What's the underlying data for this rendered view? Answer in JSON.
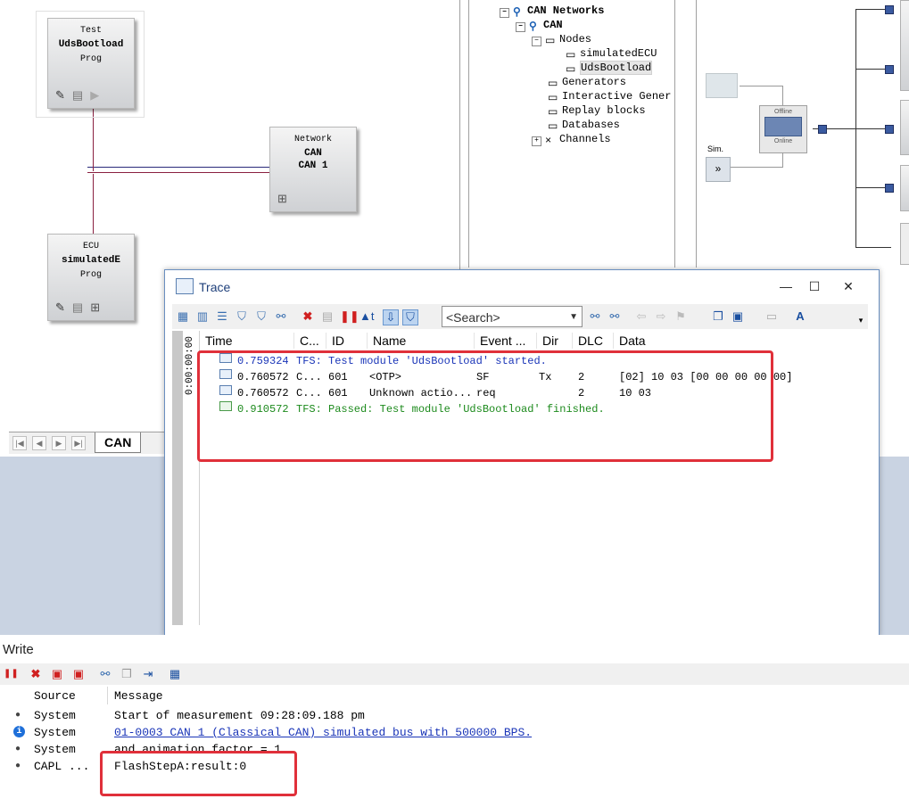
{
  "simulation": {
    "blocks": [
      {
        "line1": "Test",
        "line2": "UdsBootload",
        "line3": "Prog"
      },
      {
        "line1": "Network",
        "line2": "CAN",
        "line3": "CAN 1"
      },
      {
        "line1": "ECU",
        "line2": "simulatedE",
        "line3": "Prog"
      }
    ],
    "tab_label": "CAN"
  },
  "tree": {
    "items": [
      {
        "label": "CAN Networks",
        "icon": "network-icon",
        "bold": true
      },
      {
        "label": "CAN",
        "icon": "bus-icon",
        "bold": true
      },
      {
        "label": "Nodes",
        "icon": "nodes-icon"
      },
      {
        "label": "simulatedECU",
        "icon": "node-icon"
      },
      {
        "label": "UdsBootload",
        "icon": "node-icon"
      },
      {
        "label": "Generators",
        "icon": "generator-icon"
      },
      {
        "label": "Interactive Gener",
        "icon": "interactive-generator-icon"
      },
      {
        "label": "Replay blocks",
        "icon": "replay-icon"
      },
      {
        "label": "Databases",
        "icon": "database-icon"
      },
      {
        "label": "Channels",
        "icon": "channels-icon"
      }
    ]
  },
  "schematic": {
    "sim_label": "Sim.",
    "switch_top": "Offline",
    "switch_bottom": "Online"
  },
  "trace": {
    "title": "Trace",
    "search_placeholder": "<Search>",
    "time_axis_label": "0:00:00:00",
    "columns": [
      "Time",
      "C...",
      "ID",
      "Name",
      "Event ...",
      "Dir",
      "DLC",
      "Data"
    ],
    "rows": [
      {
        "time": "0.759324",
        "rest": "TFS: Test module 'UdsBootload' started.",
        "color": "#1a35b8",
        "kind": "tfs"
      },
      {
        "time": "0.760572",
        "chn": "C...",
        "id": "601",
        "name": "<OTP>",
        "event": "SF",
        "dir": "Tx",
        "dlc": "2",
        "data": "[02] 10 03 [00 00 00 00 00]",
        "color": "#000000",
        "kind": "msg"
      },
      {
        "time": "0.760572",
        "chn": "C...",
        "id": "601",
        "name": "Unknown actio...",
        "event": "req",
        "dir": "",
        "dlc": "2",
        "data": "10 03",
        "color": "#000000",
        "kind": "msg"
      },
      {
        "time": "0.910572",
        "rest": "TFS: Passed: Test module 'UdsBootload' finished.",
        "color": "#1c8a1c",
        "kind": "tfs"
      }
    ]
  },
  "write": {
    "title": "Write",
    "columns": [
      "Source",
      "Message"
    ],
    "rows": [
      {
        "source": "System",
        "message": "Start of measurement 09:28:09.188 pm",
        "icon": "bullet",
        "link": false
      },
      {
        "source": "System",
        "message": "01-0003 CAN 1 (Classical CAN)  simulated bus with 500000 BPS.",
        "icon": "info-icon",
        "link": true
      },
      {
        "source": "System",
        "message": "  and animation factor = 1.",
        "icon": "bullet",
        "link": false
      },
      {
        "source": "CAPL ...",
        "message": "FlashStepA:result:0",
        "icon": "bullet",
        "link": false
      }
    ]
  },
  "colors": {
    "highlight_box": "#e0303a",
    "tfs_started": "#1a35b8",
    "tfs_passed": "#1c8a1c",
    "link": "#1a35b8"
  }
}
